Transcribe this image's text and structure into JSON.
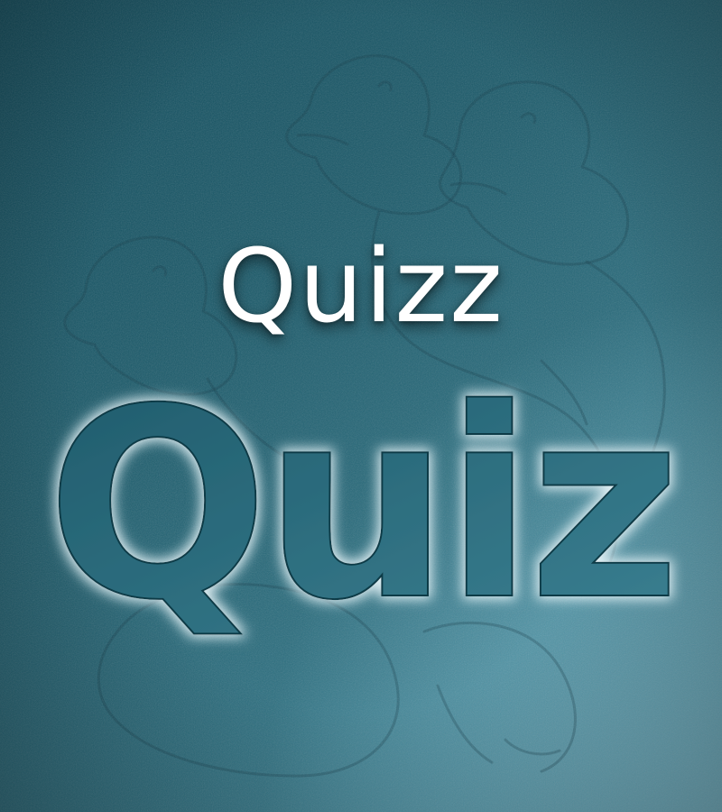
{
  "title": "Quizz",
  "hero": {
    "word": "Quiz"
  },
  "colors": {
    "background_dark": "#0f4a5a",
    "background_light": "#6fb0c2",
    "title_text": "#ffffff",
    "hero_fill": "#2e6e80",
    "hero_glow": "#e6f4f8"
  },
  "illustration": {
    "subject": "duck-outline-sketch"
  }
}
